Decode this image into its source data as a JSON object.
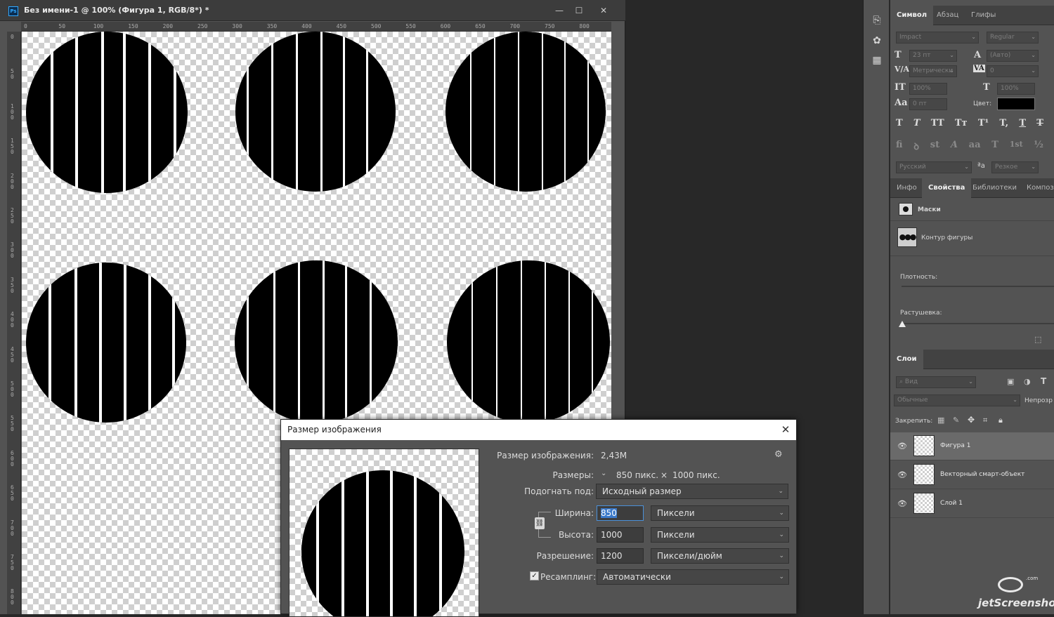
{
  "document": {
    "title": "Без имени-1 @ 100% (Фигура 1, RGB/8*) *",
    "window_buttons": [
      "—",
      "☐",
      "✕"
    ],
    "ruler_top_ticks": [
      "0",
      "50",
      "100",
      "150",
      "200",
      "250",
      "300",
      "350",
      "400",
      "450",
      "500",
      "550",
      "600",
      "650",
      "700",
      "750",
      "800"
    ],
    "ruler_left_ticks": [
      "0",
      "50",
      "100",
      "150",
      "200",
      "250",
      "300",
      "350",
      "400",
      "450",
      "500",
      "550",
      "600",
      "650",
      "700",
      "750",
      "800"
    ]
  },
  "dialog": {
    "title": "Размер изображения",
    "image_size_label": "Размер изображения:",
    "image_size_value": "2,43M",
    "dimensions_label": "Размеры:",
    "dimensions_w": "850 пикс.",
    "dimensions_x": "×",
    "dimensions_h": "1000 пикс.",
    "fit_label": "Подогнать под:",
    "fit_value": "Исходный размер",
    "width_label": "Ширина:",
    "width_value": "850",
    "width_unit": "Пиксели",
    "height_label": "Высота:",
    "height_value": "1000",
    "height_unit": "Пиксели",
    "resolution_label": "Разрешение:",
    "resolution_value": "1200",
    "resolution_unit": "Пиксели/дюйм",
    "resample_label": "Ресамплинг:",
    "resample_checked": true,
    "resample_value": "Автоматически"
  },
  "character_panel": {
    "tabs": [
      "Символ",
      "Абзац",
      "Глифы"
    ],
    "active_tab": "Символ",
    "font_family": "Impact",
    "font_style": "Regular",
    "font_size": "23 пт",
    "leading": "(Авто)",
    "kerning": "Метрически",
    "tracking": "0",
    "vertical_scale": "100%",
    "horizontal_scale": "100%",
    "baseline_shift": "0 пт",
    "color_label": "Цвет:",
    "color_value": "#000000",
    "style_buttons": [
      "T",
      "T",
      "TT",
      "Tт",
      "T¹",
      "T,",
      "T",
      "T"
    ],
    "opentype_buttons": [
      "fi",
      "ꝺ",
      "st",
      "A",
      "aa",
      "T",
      "1st",
      "½"
    ],
    "language": "Русский",
    "antialias_icon": "ªa",
    "antialias": "Резкое"
  },
  "properties_panel": {
    "tabs": [
      "Инфо",
      "Свойства",
      "Библиотеки",
      "Композ"
    ],
    "active_tab": "Свойства",
    "masks_label": "Маски",
    "shape_outline_label": "Контур фигуры",
    "density_label": "Плотность:",
    "feather_label": "Растушевка:"
  },
  "layers_panel": {
    "tab": "Слои",
    "search_placeholder": "Вид",
    "blend_mode": "Обычные",
    "opacity_label": "Непрозр",
    "lock_label": "Закрепить:",
    "layers": [
      {
        "name": "Фигура 1",
        "visible": true,
        "selected": true
      },
      {
        "name": "Векторный смарт-объект",
        "visible": true,
        "selected": false
      },
      {
        "name": "Слой 1",
        "visible": true,
        "selected": false
      }
    ]
  },
  "watermark": {
    "text": "jetScreenshot",
    "suffix": ".com"
  }
}
